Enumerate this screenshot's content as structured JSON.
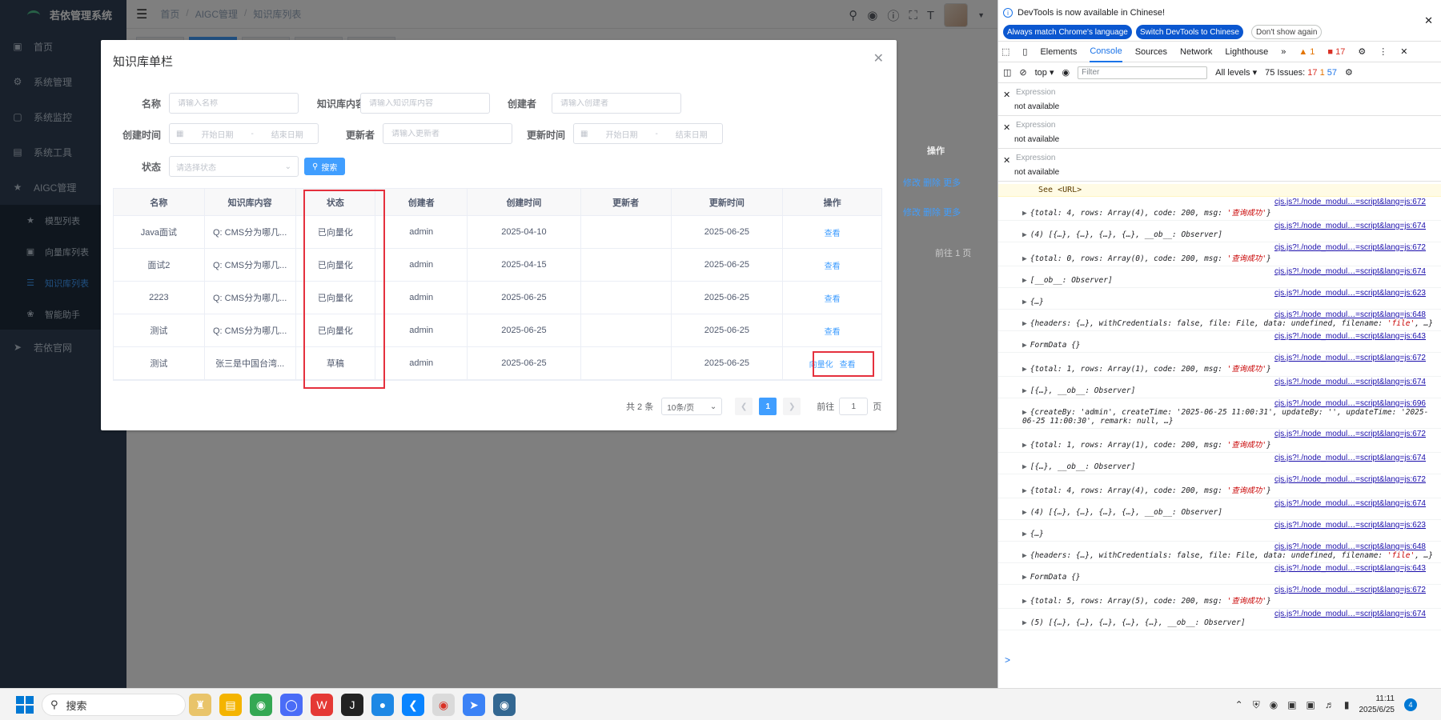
{
  "app": {
    "title": "若依管理系统"
  },
  "sidebar": {
    "items": [
      {
        "label": "首页",
        "icon": "dashboard-icon"
      },
      {
        "label": "系统管理",
        "icon": "system-icon"
      },
      {
        "label": "系统监控",
        "icon": "monitor-icon"
      },
      {
        "label": "系统工具",
        "icon": "tool-icon"
      },
      {
        "label": "AIGC管理",
        "icon": "star-icon"
      }
    ],
    "sub_items": [
      {
        "label": "模型列表",
        "icon": "star-icon"
      },
      {
        "label": "向量库列表",
        "icon": "cube-icon"
      },
      {
        "label": "知识库列表",
        "icon": "list-icon",
        "active": true
      },
      {
        "label": "智能助手",
        "icon": "brain-icon"
      }
    ],
    "extra": {
      "label": "若依官网",
      "icon": "guide-icon"
    }
  },
  "navbar": {
    "breadcrumb": [
      "首页",
      "AIGC管理",
      "知识库列表"
    ],
    "breadcrumb_sep": "/"
  },
  "background_page": {
    "header": "操作",
    "row_actions": [
      "修改",
      "删除",
      "更多"
    ],
    "jump_label": "前往",
    "jump_value": "1",
    "page_unit": "页"
  },
  "dialog": {
    "title": "知识库单栏",
    "form": {
      "name": {
        "label": "名称",
        "placeholder": "请输入名称"
      },
      "content": {
        "label": "知识库内容",
        "placeholder": "请输入知识库内容"
      },
      "creator": {
        "label": "创建者",
        "placeholder": "请输入创建者"
      },
      "create_time": {
        "label": "创建时间",
        "start": "开始日期",
        "end": "结束日期",
        "sep": "-"
      },
      "updater": {
        "label": "更新者",
        "placeholder": "请输入更新者"
      },
      "update_time": {
        "label": "更新时间",
        "start": "开始日期",
        "end": "结束日期",
        "sep": "-"
      },
      "status": {
        "label": "状态",
        "placeholder": "请选择状态"
      },
      "search_button": "搜索"
    },
    "table": {
      "columns": [
        "名称",
        "知识库内容",
        "状态",
        "创建者",
        "创建时间",
        "更新者",
        "更新时间",
        "操作"
      ],
      "rows": [
        {
          "name": "Java面试",
          "content": "Q: CMS分为哪几...",
          "status": "已向量化",
          "creator": "admin",
          "create_time": "2025-04-10",
          "updater": "",
          "update_time": "2025-06-25",
          "actions": [
            "查看"
          ]
        },
        {
          "name": "面试2",
          "content": "Q: CMS分为哪几...",
          "status": "已向量化",
          "creator": "admin",
          "create_time": "2025-04-15",
          "updater": "",
          "update_time": "2025-06-25",
          "actions": [
            "查看"
          ]
        },
        {
          "name": "2223",
          "content": "Q: CMS分为哪几...",
          "status": "已向量化",
          "creator": "admin",
          "create_time": "2025-06-25",
          "updater": "",
          "update_time": "2025-06-25",
          "actions": [
            "查看"
          ]
        },
        {
          "name": "测试",
          "content": "Q: CMS分为哪几...",
          "status": "已向量化",
          "creator": "admin",
          "create_time": "2025-06-25",
          "updater": "",
          "update_time": "2025-06-25",
          "actions": [
            "查看"
          ]
        },
        {
          "name": "测试",
          "content": "张三是中国台湾...",
          "status": "草稿",
          "creator": "admin",
          "create_time": "2025-06-25",
          "updater": "",
          "update_time": "2025-06-25",
          "actions": [
            "向量化",
            "查看"
          ]
        }
      ]
    },
    "pagination": {
      "total": "共 2 条",
      "page_size": "10条/页",
      "current": "1",
      "jump_label": "前往",
      "jump_value": "1",
      "page_unit": "页"
    }
  },
  "devtools": {
    "banner": {
      "text": "DevTools is now available in Chinese!",
      "btn_match": "Always match Chrome's language",
      "btn_switch": "Switch DevTools to Chinese",
      "btn_dismiss": "Don't show again"
    },
    "tabs": [
      "Elements",
      "Console",
      "Sources",
      "Network",
      "Lighthouse"
    ],
    "active_tab": "Console",
    "badges": {
      "warnings": "1",
      "errors": "17"
    },
    "toolbar": {
      "context": "top",
      "filter_placeholder": "Filter",
      "levels": "All levels",
      "issues_label": "75 Issues:",
      "issues_errors": "17",
      "issues_warnings": "1",
      "issues_info": "57"
    },
    "expressions": [
      {
        "placeholder": "Expression",
        "value": "not available"
      },
      {
        "placeholder": "Expression",
        "value": "not available"
      },
      {
        "placeholder": "Expression",
        "value": "not available"
      }
    ],
    "warning_line": "See <URL>",
    "logs": [
      {
        "src": "cjs.js?!./node_modul…=script&lang=js:672",
        "msg": "{total: 4, rows: Array(4), code: 200, msg: ",
        "str": "'查询成功'",
        "tail": "}"
      },
      {
        "src": "cjs.js?!./node_modul…=script&lang=js:674",
        "msg": "(4) [{…}, {…}, {…}, {…}, __ob__: Observer]",
        "str": "",
        "tail": ""
      },
      {
        "src": "cjs.js?!./node_modul…=script&lang=js:672",
        "msg": "{total: 0, rows: Array(0), code: 200, msg: ",
        "str": "'查询成功'",
        "tail": "}"
      },
      {
        "src": "cjs.js?!./node_modul…=script&lang=js:674",
        "msg": "[__ob__: Observer]",
        "str": "",
        "tail": ""
      },
      {
        "src": "cjs.js?!./node_modul…=script&lang=js:623",
        "msg": "{…}",
        "str": "",
        "tail": ""
      },
      {
        "src": "cjs.js?!./node_modul…=script&lang=js:648",
        "msg": "{headers: {…}, withCredentials: false, file: File, data: undefined, filename: ",
        "str": "'file'",
        "tail": ", …}"
      },
      {
        "src": "cjs.js?!./node_modul…=script&lang=js:643",
        "msg": "FormData {}",
        "str": "",
        "tail": ""
      },
      {
        "src": "cjs.js?!./node_modul…=script&lang=js:672",
        "msg": "{total: 1, rows: Array(1), code: 200, msg: ",
        "str": "'查询成功'",
        "tail": "}"
      },
      {
        "src": "cjs.js?!./node_modul…=script&lang=js:674",
        "msg": "[{…}, __ob__: Observer]",
        "str": "",
        "tail": ""
      },
      {
        "src": "cjs.js?!./node_modul…=script&lang=js:696",
        "msg": "{createBy: 'admin', createTime: '2025-06-25 11:00:31', updateBy: '', updateTime: '2025-06-25 11:00:30', remark: null, …}",
        "str": "",
        "tail": ""
      },
      {
        "src": "cjs.js?!./node_modul…=script&lang=js:672",
        "msg": "{total: 1, rows: Array(1), code: 200, msg: ",
        "str": "'查询成功'",
        "tail": "}"
      },
      {
        "src": "cjs.js?!./node_modul…=script&lang=js:674",
        "msg": "[{…}, __ob__: Observer]",
        "str": "",
        "tail": ""
      },
      {
        "src": "cjs.js?!./node_modul…=script&lang=js:672",
        "msg": "{total: 4, rows: Array(4), code: 200, msg: ",
        "str": "'查询成功'",
        "tail": "}"
      },
      {
        "src": "cjs.js?!./node_modul…=script&lang=js:674",
        "msg": "(4) [{…}, {…}, {…}, {…}, __ob__: Observer]",
        "str": "",
        "tail": ""
      },
      {
        "src": "cjs.js?!./node_modul…=script&lang=js:623",
        "msg": "{…}",
        "str": "",
        "tail": ""
      },
      {
        "src": "cjs.js?!./node_modul…=script&lang=js:648",
        "msg": "{headers: {…}, withCredentials: false, file: File, data: undefined, filename: ",
        "str": "'file'",
        "tail": ", …}"
      },
      {
        "src": "cjs.js?!./node_modul…=script&lang=js:643",
        "msg": "FormData {}",
        "str": "",
        "tail": ""
      },
      {
        "src": "cjs.js?!./node_modul…=script&lang=js:672",
        "msg": "{total: 5, rows: Array(5), code: 200, msg: ",
        "str": "'查询成功'",
        "tail": "}"
      },
      {
        "src": "cjs.js?!./node_modul…=script&lang=js:674",
        "msg": "(5) [{…}, {…}, {…}, {…}, {…}, __ob__: Observer]",
        "str": "",
        "tail": ""
      }
    ],
    "prompt": ">"
  },
  "taskbar": {
    "search_placeholder": "搜索",
    "time": "11:11",
    "date": "2025/6/25",
    "notification_count": "4"
  },
  "colors": {
    "primary": "#409eff",
    "sidebar_bg": "#304156",
    "highlight_box": "#e5303d"
  }
}
